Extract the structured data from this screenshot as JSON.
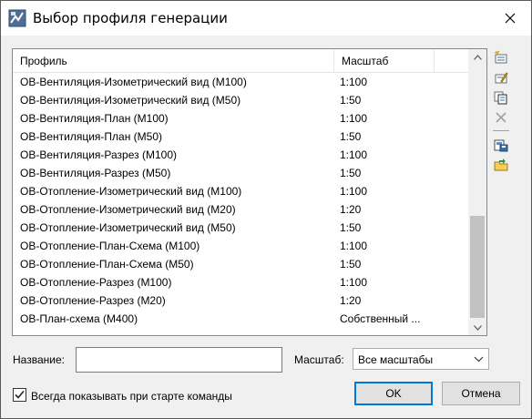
{
  "window": {
    "title": "Выбор профиля генерации"
  },
  "list": {
    "columns": [
      "Профиль",
      "Масштаб"
    ],
    "rows": [
      {
        "profile": "ОВ-Вентиляция-Изометрический вид (М100)",
        "scale": "1:100"
      },
      {
        "profile": "ОВ-Вентиляция-Изометрический вид (М50)",
        "scale": "1:50"
      },
      {
        "profile": "ОВ-Вентиляция-План (М100)",
        "scale": "1:100"
      },
      {
        "profile": "ОВ-Вентиляция-План (М50)",
        "scale": "1:50"
      },
      {
        "profile": "ОВ-Вентиляция-Разрез (М100)",
        "scale": "1:100"
      },
      {
        "profile": "ОВ-Вентиляция-Разрез (М50)",
        "scale": "1:50"
      },
      {
        "profile": "ОВ-Отопление-Изометрический вид (М100)",
        "scale": "1:100"
      },
      {
        "profile": "ОВ-Отопление-Изометрический вид (М20)",
        "scale": "1:20"
      },
      {
        "profile": "ОВ-Отопление-Изометрический вид (М50)",
        "scale": "1:50"
      },
      {
        "profile": "ОВ-Отопление-План-Схема (М100)",
        "scale": "1:100"
      },
      {
        "profile": "ОВ-Отопление-План-Схема (М50)",
        "scale": "1:50"
      },
      {
        "profile": "ОВ-Отопление-Разрез (М100)",
        "scale": "1:100"
      },
      {
        "profile": "ОВ-Отопление-Разрез (М20)",
        "scale": "1:20"
      },
      {
        "profile": "ОВ-План-схема (М400)",
        "scale": "Собственный ..."
      }
    ]
  },
  "toolbar": {
    "icons": [
      "new-profile-icon",
      "edit-profile-icon",
      "copy-profile-icon",
      "delete-profile-icon",
      "export-profile-icon",
      "import-profile-icon"
    ]
  },
  "form": {
    "name_label": "Название:",
    "name_value": "",
    "scale_label": "Масштаб:",
    "scale_value": "Все масштабы",
    "checkbox_label": "Всегда показывать при старте команды",
    "checkbox_checked": true
  },
  "buttons": {
    "ok": "OK",
    "cancel": "Отмена"
  },
  "colors": {
    "accent": "#0078d7",
    "scroll_thumb": "#c2c2c2"
  }
}
